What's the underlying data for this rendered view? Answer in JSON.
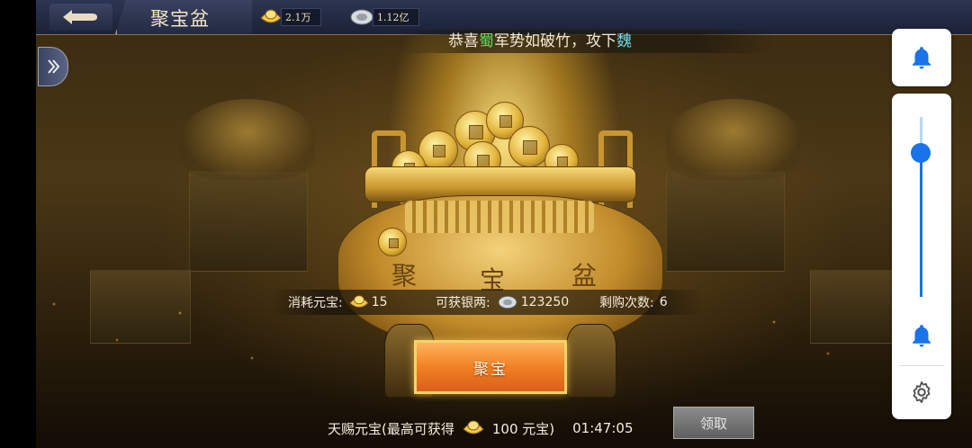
{
  "header": {
    "title": "聚宝盆",
    "gold": {
      "icon": "gold-ingot-icon",
      "value": "2.1万"
    },
    "silver": {
      "icon": "silver-ingot-icon",
      "value": "1.12亿"
    }
  },
  "announcement": {
    "prefix": "恭喜",
    "faction": "蜀",
    "middle": "军势如破竹，攻下",
    "city": "魏"
  },
  "bowl_labels": [
    "聚",
    "宝",
    "盆"
  ],
  "info": {
    "cost_label": "消耗元宝:",
    "cost_value": "15",
    "gain_label": "可获银两:",
    "gain_value": "123250",
    "remaining_label": "剩购次数:",
    "remaining_value": "6"
  },
  "action_button": "聚宝",
  "bonus": {
    "label": "天赐元宝(最高可获得",
    "amount": "100 元宝)",
    "timer": "01:47:05",
    "claim_label": "领取"
  },
  "volume": {
    "level": 0.8,
    "top_icon": "bell-icon",
    "ring_icon": "bell-icon",
    "settings_icon": "gear-icon",
    "accent": "#1a73e8"
  }
}
